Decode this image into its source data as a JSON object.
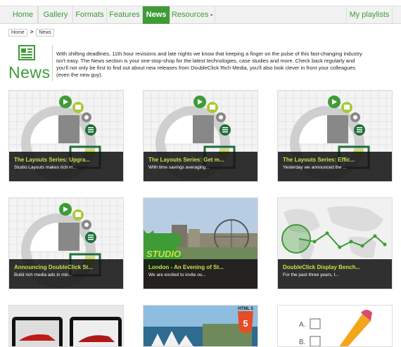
{
  "nav": {
    "items": [
      {
        "label": "Home",
        "active": false
      },
      {
        "label": "Gallery",
        "active": false
      },
      {
        "label": "Formats",
        "active": false
      },
      {
        "label": "Features",
        "active": false
      },
      {
        "label": "News",
        "active": true
      },
      {
        "label": "Resources",
        "active": false,
        "caret": "▸"
      }
    ],
    "playlists": "My playlists"
  },
  "breadcrumb": {
    "home": "Home",
    "separator": ">",
    "current": "News"
  },
  "header": {
    "title": "News",
    "intro": "With shifting deadlines, 11th hour revisions and late nights we know that keeping a finger on the pulse of this fast-changing industry isn't easy. The News section is your one-stop-shop for the latest technologies, case studies and more. Check back regularly and you'll not only be first to find out about new releases from DoubleClick Rich Media, you'll also look clever in front your colleagues (even the new guy)."
  },
  "cards": [
    {
      "title": "The Layouts Series: Upgra...",
      "subtitle": "Studio Layouts makes rich m...",
      "image": "layouts-graphic"
    },
    {
      "title": "The Layouts Series: Get m...",
      "subtitle": "With time savings averaging...",
      "image": "layouts-graphic"
    },
    {
      "title": "The Layouts Series: Effic...",
      "subtitle": "Yesterday we announced the ...",
      "image": "layouts-graphic"
    },
    {
      "title": "Announcing DoubleClick St...",
      "subtitle": "Build rich media ads in min...",
      "image": "layouts-graphic"
    },
    {
      "title": "London - An Evening of St...",
      "subtitle": "We are excited to invite ou...",
      "image": "london-photo",
      "badge": "STUDIO"
    },
    {
      "title": "DoubleClick Display Bench...",
      "subtitle": "For the past three years, t...",
      "image": "world-map"
    }
  ],
  "bottom_cards": [
    {
      "image": "tablets-photo"
    },
    {
      "image": "sydney-html5-photo",
      "badge": "HTML 5"
    },
    {
      "image": "quiz-pencil",
      "labels": [
        "A.",
        "B."
      ]
    }
  ],
  "colors": {
    "accent": "#3f9b36",
    "caption_title": "#c9e04a"
  }
}
